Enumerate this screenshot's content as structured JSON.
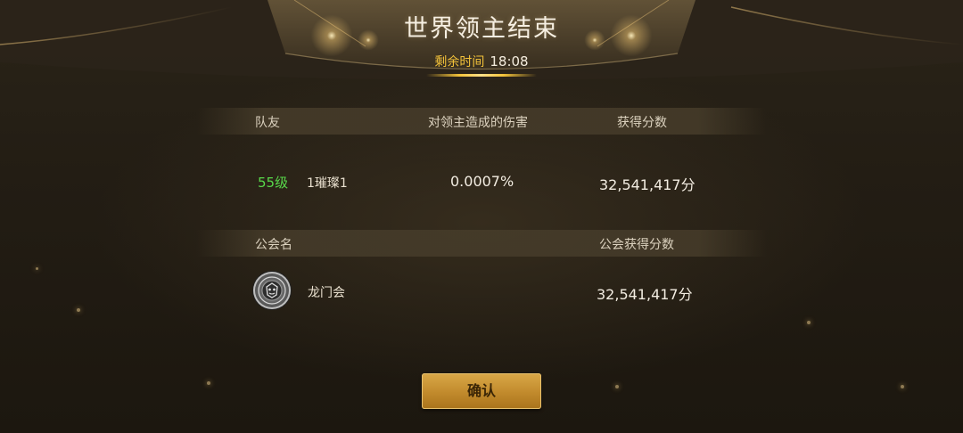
{
  "header": {
    "title": "世界领主结束",
    "timer_label": "剩余时间",
    "timer_value": "18:08"
  },
  "team_table": {
    "columns": [
      "队友",
      "对领主造成的伤害",
      "获得分数"
    ],
    "rows": [
      {
        "level": "55级",
        "name": "1璀璨1",
        "damage": "0.0007%",
        "score": "32,541,417分"
      }
    ]
  },
  "guild_table": {
    "columns": [
      "公会名",
      "公会获得分数"
    ],
    "rows": [
      {
        "emblem_icon": "guild-emblem-icon",
        "name": "龙门会",
        "score": "32,541,417分"
      }
    ]
  },
  "confirm_label": "确认",
  "colors": {
    "accent_gold": "#f3c23a",
    "level_green": "#58d84a",
    "button_gold": "#c18a2c",
    "background": "#231d14"
  }
}
